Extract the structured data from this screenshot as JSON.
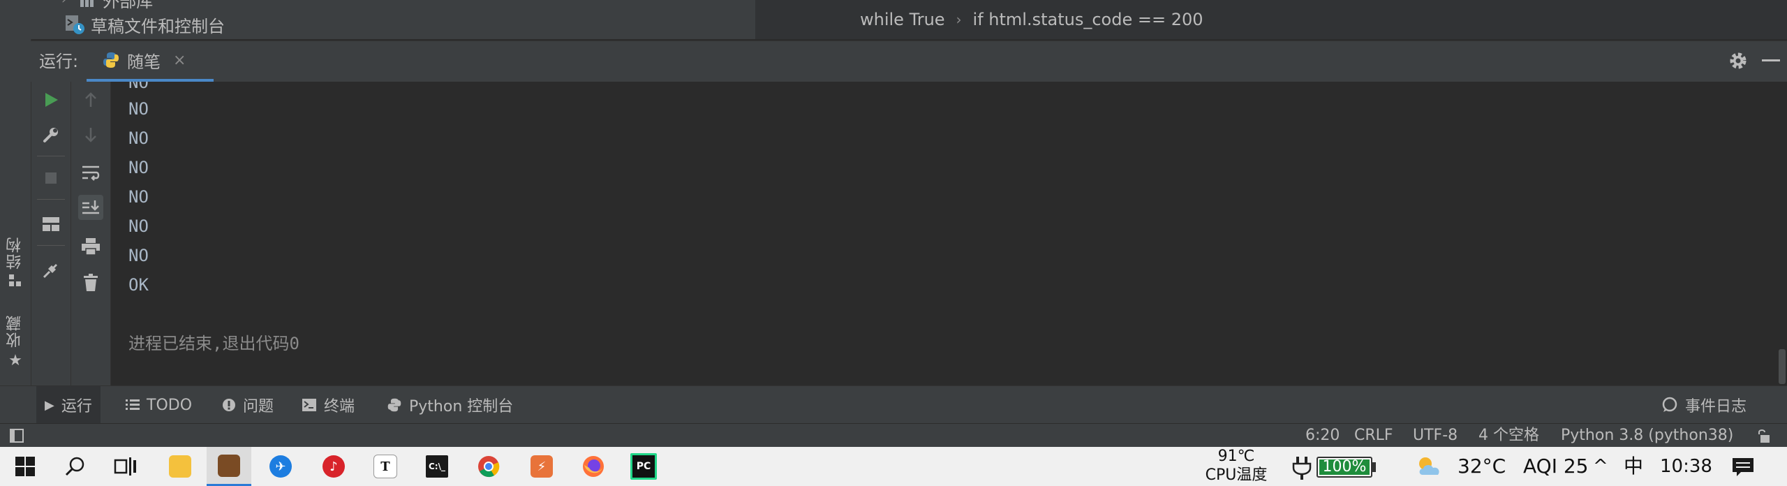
{
  "project_tree": {
    "row1_label": "外部库",
    "row2_label": "草稿文件和控制台"
  },
  "breadcrumb": {
    "items": [
      "while True",
      "if html.status_code == 200"
    ],
    "separator": "›"
  },
  "run_window": {
    "title": "运行:",
    "tab_label": "随笔",
    "tab_close": "×"
  },
  "left_stripe": {
    "structure_label": "结构",
    "favorites_label": "收藏"
  },
  "console": {
    "lines": [
      "NO",
      "NO",
      "NO",
      "NO",
      "NO",
      "NO",
      "NO",
      "OK"
    ],
    "exit_message": "进程已结束,退出代码0"
  },
  "bottom_tabs": {
    "run": "运行",
    "todo": "TODO",
    "problems": "问题",
    "terminal": "终端",
    "python_console": "Python 控制台",
    "event_log": "事件日志"
  },
  "status_bar": {
    "position": "6:20",
    "line_separator": "CRLF",
    "encoding": "UTF-8",
    "indent": "4 个空格",
    "interpreter": "Python 3.8 (python38)"
  },
  "taskbar": {
    "cpu_temp": "91℃",
    "cpu_label": "CPU温度",
    "battery_percent": "100%",
    "battery_level": 1.0,
    "weather_temp": "32°C",
    "aqi": "AQI 25",
    "tray_chevron": "^",
    "ime": "中",
    "clock": "10:38"
  },
  "colors": {
    "run_green": "#499c54",
    "tab_underline": "#4a88c7",
    "battery_green": "#1f8d3c"
  }
}
